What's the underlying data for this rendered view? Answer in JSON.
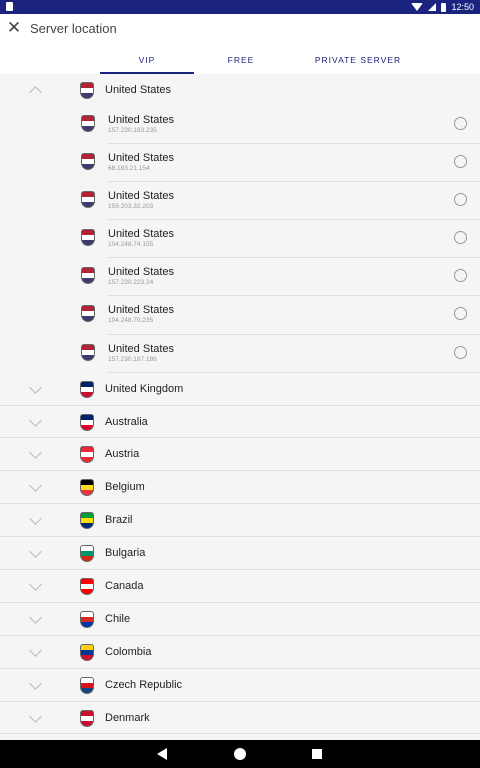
{
  "status": {
    "time": "12:50"
  },
  "app_bar": {
    "title": "Server location"
  },
  "tabs": [
    {
      "label": "VIP",
      "active": true
    },
    {
      "label": "FREE",
      "active": false
    },
    {
      "label": "PRIVATE SERVER",
      "active": false
    }
  ],
  "expanded_country": {
    "name": "United States",
    "flag": "us",
    "servers": [
      {
        "name": "United States",
        "ip": "157.230.183.235"
      },
      {
        "name": "United States",
        "ip": "68.183.21.154"
      },
      {
        "name": "United States",
        "ip": "159.203.32.203"
      },
      {
        "name": "United States",
        "ip": "104.248.74.155"
      },
      {
        "name": "United States",
        "ip": "157.230.223.24"
      },
      {
        "name": "United States",
        "ip": "104.248.70.235"
      },
      {
        "name": "United States",
        "ip": "157.230.187.186"
      }
    ]
  },
  "countries": [
    {
      "name": "United Kingdom",
      "flag": "uk"
    },
    {
      "name": "Australia",
      "flag": "au"
    },
    {
      "name": "Austria",
      "flag": "at"
    },
    {
      "name": "Belgium",
      "flag": "be"
    },
    {
      "name": "Brazil",
      "flag": "br"
    },
    {
      "name": "Bulgaria",
      "flag": "bg"
    },
    {
      "name": "Canada",
      "flag": "ca"
    },
    {
      "name": "Chile",
      "flag": "cl"
    },
    {
      "name": "Colombia",
      "flag": "co"
    },
    {
      "name": "Czech Republic",
      "flag": "cz"
    },
    {
      "name": "Denmark",
      "flag": "dk"
    }
  ],
  "flag_colors": {
    "us": [
      "#b22234",
      "#ffffff",
      "#3c3b6e"
    ],
    "uk": [
      "#012169",
      "#ffffff",
      "#c8102e"
    ],
    "au": [
      "#012169",
      "#ffffff",
      "#e4002b"
    ],
    "at": [
      "#ed2939",
      "#ffffff",
      "#ed2939"
    ],
    "be": [
      "#000000",
      "#fdda24",
      "#ef3340"
    ],
    "br": [
      "#009c3b",
      "#ffdf00",
      "#002776"
    ],
    "bg": [
      "#ffffff",
      "#00966e",
      "#d62612"
    ],
    "ca": [
      "#ff0000",
      "#ffffff",
      "#ff0000"
    ],
    "cl": [
      "#ffffff",
      "#d52b1e",
      "#0039a6"
    ],
    "co": [
      "#fcd116",
      "#003893",
      "#ce1126"
    ],
    "cz": [
      "#ffffff",
      "#d7141a",
      "#11457e"
    ],
    "dk": [
      "#c8102e",
      "#ffffff",
      "#c8102e"
    ]
  },
  "icons": {
    "close": "close-icon",
    "chevron": "chevron-icon",
    "radio": "radio-icon"
  }
}
